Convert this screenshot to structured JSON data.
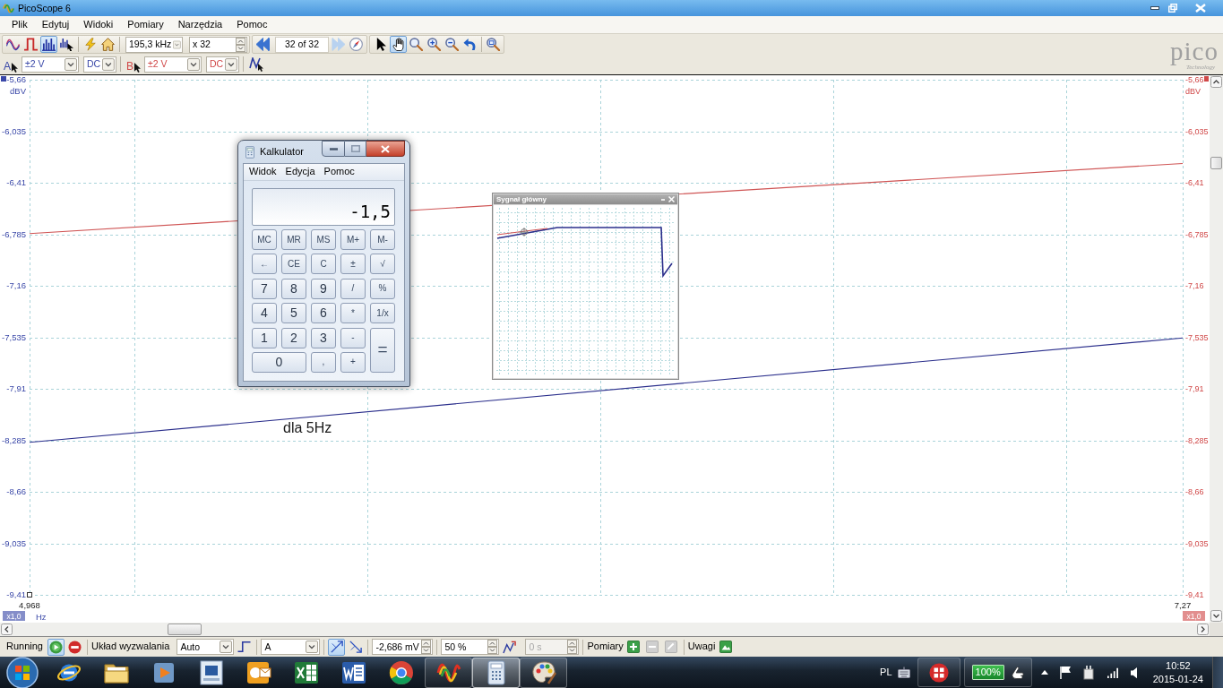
{
  "window": {
    "title": "PicoScope 6"
  },
  "menu": [
    "Plik",
    "Edytuj",
    "Widoki",
    "Pomiary",
    "Narzędzia",
    "Pomoc"
  ],
  "toolbar": {
    "view_modes": [
      {
        "kind": "scope",
        "selected": false
      },
      {
        "kind": "persistence",
        "selected": false
      },
      {
        "kind": "spectrum",
        "selected": true
      },
      {
        "kind": "spectrum_options",
        "selected": false
      }
    ],
    "rate": "195,3 kHz",
    "captures": "x 32",
    "navigation": [
      {
        "kind": "previous",
        "disabled": false
      },
      {
        "kind": "next",
        "disabled": true
      }
    ],
    "buffer_position": "32 of 32",
    "tools": [
      {
        "kind": "pointer",
        "selected": false
      },
      {
        "kind": "hand",
        "selected": true
      },
      {
        "kind": "zoom",
        "selected": false
      },
      {
        "kind": "zoom_in",
        "selected": false
      },
      {
        "kind": "zoom_out",
        "selected": false
      },
      {
        "kind": "undo",
        "selected": false
      },
      {
        "kind": "zoom_fit",
        "selected": false
      }
    ]
  },
  "channels": [
    {
      "label": "A",
      "range": "±2 V",
      "coupling": "DC",
      "color": "#3a48a8"
    },
    {
      "label": "B",
      "range": "±2 V",
      "coupling": "DC",
      "color": "#d04848"
    }
  ],
  "logo": {
    "name": "pico",
    "tagline": "Technology"
  },
  "plot": {
    "left_axis": {
      "intermediate_ticks": [
        "-6,035",
        "-6,785",
        "-7,535",
        "-8,285",
        "-9,035"
      ]
    },
    "chart_data": {
      "type": "line",
      "xlabel": "Hz",
      "ylabel": "dBV",
      "categories": [
        "4,968",
        "7,27"
      ],
      "series": [
        {
          "color": "#2b2f8c",
          "values": [
            -8.3,
            -7.54
          ]
        },
        {
          "color": "#cf5454",
          "values": [
            -6.78,
            -6.27
          ]
        }
      ],
      "ylim": [
        -9.41,
        -5.66
      ],
      "yticks": [
        {
          "value": -5.66,
          "label": "-5,66"
        },
        {
          "value": -6.41,
          "label": "-6,41"
        },
        {
          "value": -7.16,
          "label": "-7,16"
        },
        {
          "value": -7.91,
          "label": "-7,91"
        },
        {
          "value": -8.66,
          "label": "-8,66"
        },
        {
          "value": -9.41,
          "label": "-9,41"
        }
      ],
      "annotations": [
        "dla 5Hz"
      ]
    },
    "right_axis": {
      "ylabel": "dBV",
      "yticks": [
        "-5,66",
        "-6,035",
        "-6,41",
        "-6,785",
        "-7,16",
        "-7,535",
        "-7,91",
        "-8,285",
        "-8,66",
        "-9,035",
        "-9,41"
      ]
    },
    "zoom_labels": [
      "x1,0",
      "x1,0"
    ]
  },
  "calculator": {
    "title": "Kalkulator",
    "menu": [
      "Widok",
      "Edycja",
      "Pomoc"
    ],
    "display": "-1,5",
    "keys": [
      {
        "label": "MC",
        "kind": "function"
      },
      {
        "label": "MR",
        "kind": "function"
      },
      {
        "label": "MS",
        "kind": "function"
      },
      {
        "label": "M+",
        "kind": "function"
      },
      {
        "label": "M-",
        "kind": "function"
      },
      {
        "label": "←",
        "kind": "function"
      },
      {
        "label": "CE",
        "kind": "function"
      },
      {
        "label": "C",
        "kind": "function"
      },
      {
        "label": "±",
        "kind": "function"
      },
      {
        "label": "√",
        "kind": "function"
      },
      {
        "label": "7",
        "kind": "digit"
      },
      {
        "label": "8",
        "kind": "digit"
      },
      {
        "label": "9",
        "kind": "digit"
      },
      {
        "label": "/",
        "kind": "function"
      },
      {
        "label": "%",
        "kind": "function"
      },
      {
        "label": "4",
        "kind": "digit"
      },
      {
        "label": "5",
        "kind": "digit"
      },
      {
        "label": "6",
        "kind": "digit"
      },
      {
        "label": "*",
        "kind": "function"
      },
      {
        "label": "1/x",
        "kind": "function"
      },
      {
        "label": "1",
        "kind": "digit"
      },
      {
        "label": "2",
        "kind": "digit"
      },
      {
        "label": "3",
        "kind": "digit"
      },
      {
        "label": "-",
        "kind": "function"
      },
      {
        "label": "=",
        "kind": "equals"
      },
      {
        "label": "0",
        "kind": "wide_digit"
      },
      {
        "label": ",",
        "kind": "function"
      },
      {
        "label": "+",
        "kind": "function"
      }
    ]
  },
  "overview": {
    "title": "Sygnał główny"
  },
  "status_bar": {
    "state": "Running",
    "run_buttons": [
      {
        "kind": "start",
        "selected": true
      },
      {
        "kind": "stop",
        "selected": false
      }
    ],
    "trigger_label": "Układ wyzwalania",
    "trigger_mode": "Auto",
    "trigger_source": "A",
    "edges": [
      {
        "kind": "rising",
        "selected": true
      },
      {
        "kind": "falling",
        "selected": false
      }
    ],
    "threshold": "-2,686 mV",
    "pre_trigger": "50 %",
    "delay": {
      "value": "0 s",
      "disabled": true
    },
    "measurements_label": "Pomiary",
    "measurement_buttons": [
      {
        "kind": "add",
        "disabled": false
      },
      {
        "kind": "remove",
        "disabled": true
      },
      {
        "kind": "edit",
        "disabled": true
      }
    ],
    "notes_label": "Uwagi"
  },
  "taskbar": {
    "apps": [
      {
        "kind": "browser",
        "running": false,
        "selected": false
      },
      {
        "kind": "folder",
        "running": false,
        "selected": false
      },
      {
        "kind": "media",
        "running": false,
        "selected": false
      },
      {
        "kind": "app",
        "running": false,
        "selected": false
      },
      {
        "kind": "mail",
        "running": false,
        "selected": false
      },
      {
        "kind": "spreadsheet",
        "running": false,
        "selected": false
      },
      {
        "kind": "document",
        "running": false,
        "selected": false
      },
      {
        "kind": "web",
        "running": false,
        "selected": false
      },
      {
        "kind": "scope",
        "running": true,
        "selected": false
      },
      {
        "kind": "calculator",
        "running": true,
        "selected": true
      },
      {
        "kind": "paint",
        "running": true,
        "selected": false
      }
    ],
    "language": "PL",
    "battery": "100%",
    "time": "10:52",
    "date": "2015-01-24"
  }
}
